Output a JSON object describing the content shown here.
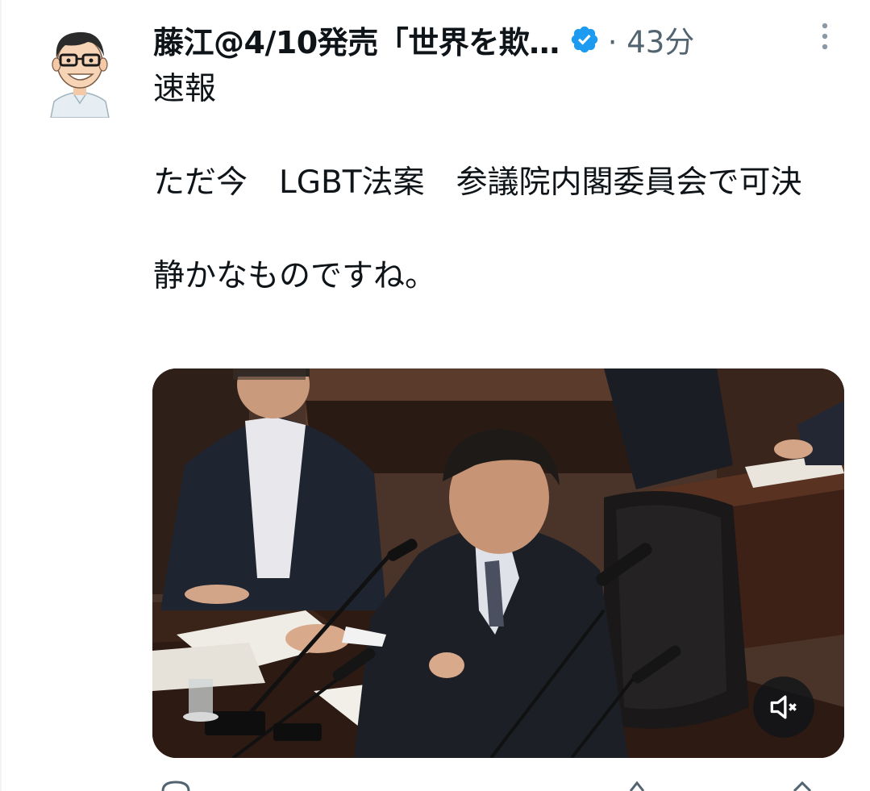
{
  "tweet": {
    "author": {
      "display_name": "藤江@4/10発売「世界を欺…",
      "verified": true,
      "avatar_icon": "cartoon-man-with-glasses-avatar"
    },
    "timestamp": "· 43分",
    "body": "速報\n\nただ今　LGBT法案　参議院内閣委員会で可決\n\n静かなものですね。",
    "media": {
      "type": "video",
      "muted": true,
      "mute_icon": "speaker-muted-icon"
    },
    "more_icon": "vertical-ellipsis-icon"
  },
  "colors": {
    "text_primary": "#0f1419",
    "text_secondary": "#536471",
    "verified_blue": "#1d9bf0",
    "border": "#eff3f4"
  }
}
